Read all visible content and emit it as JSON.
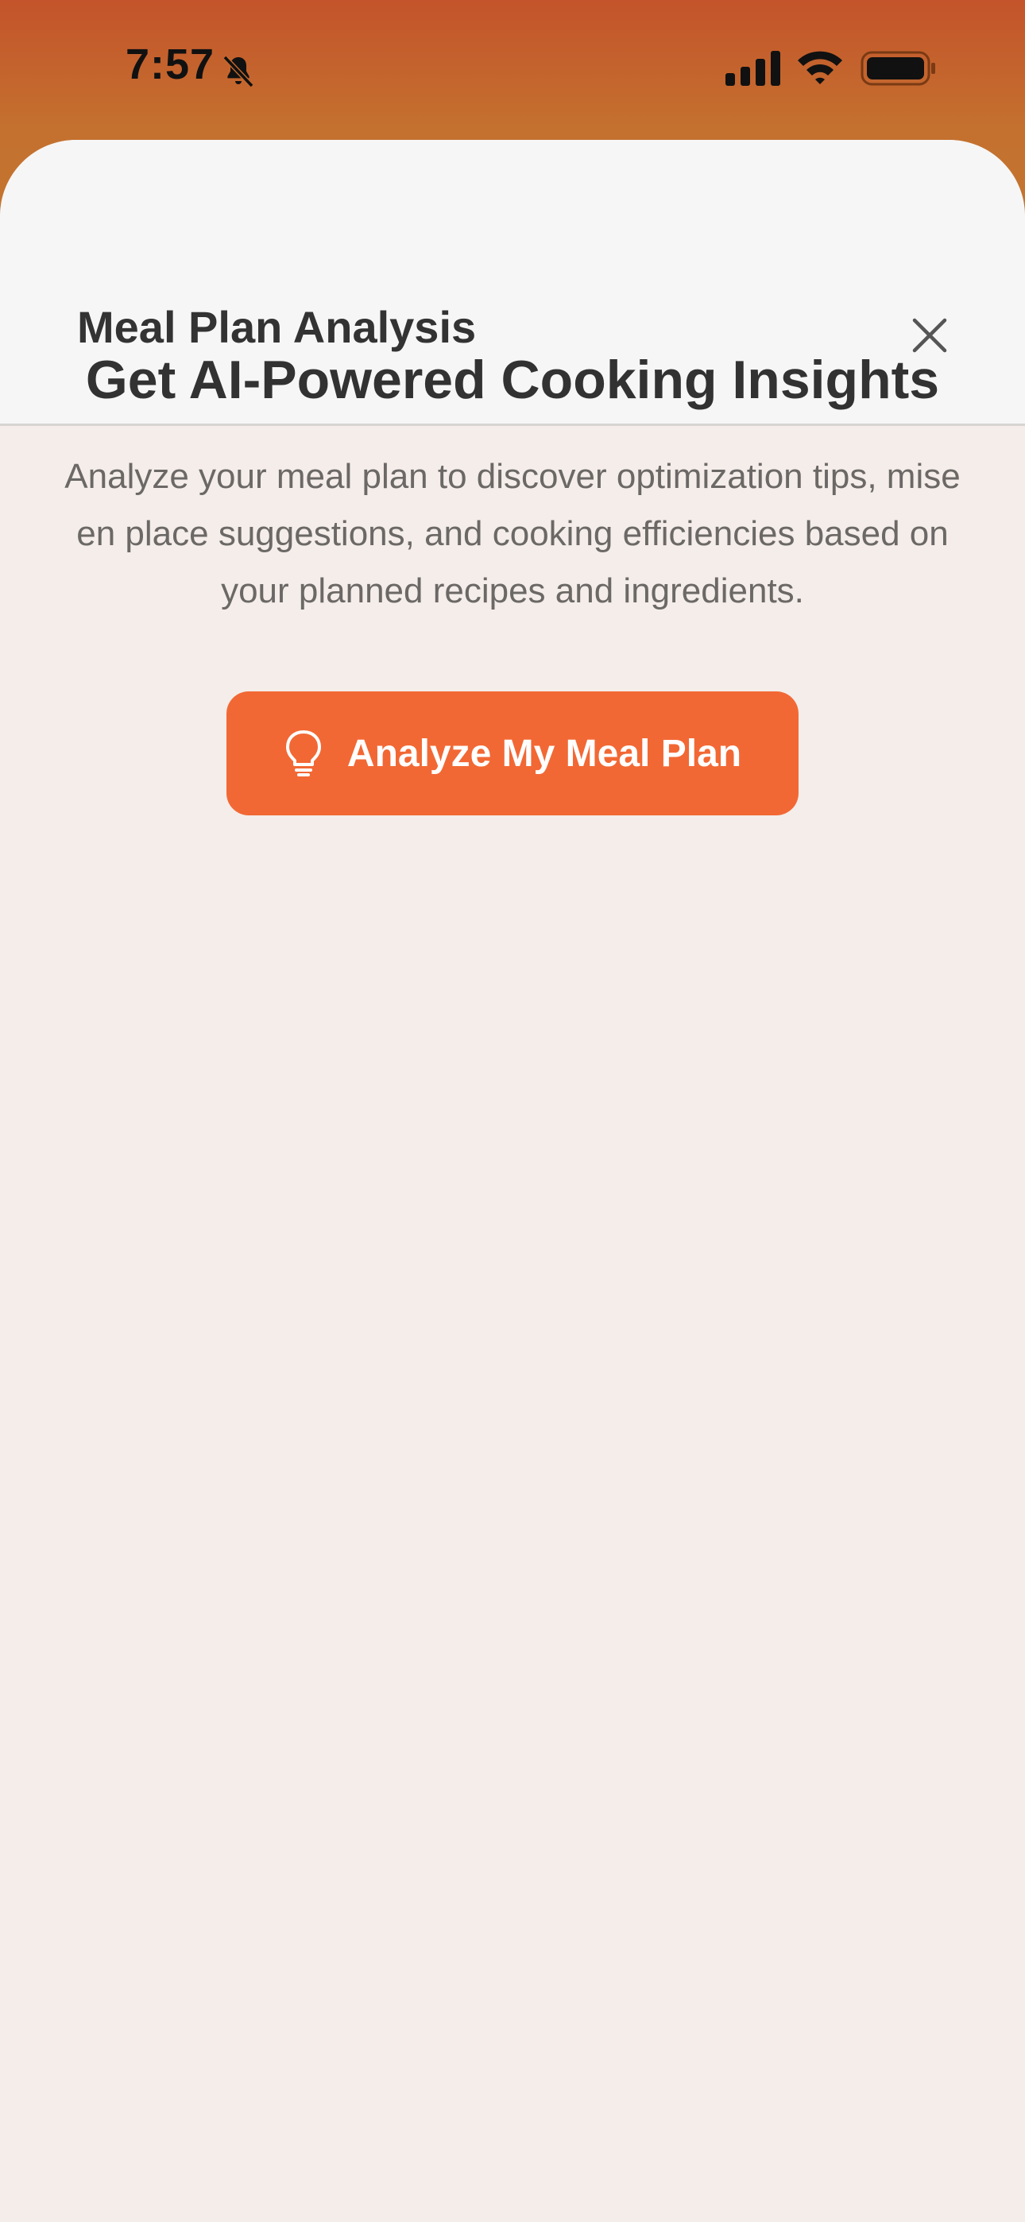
{
  "status_bar": {
    "time": "7:57",
    "icons": [
      "bell-muted-icon",
      "signal-icon",
      "wifi-icon",
      "battery-icon"
    ]
  },
  "sheet": {
    "title": "Meal Plan Analysis",
    "close_icon": "close-icon"
  },
  "content": {
    "headline": "Get AI-Powered Cooking Insights",
    "description": "Analyze your meal plan to discover optimization tips, mise en place suggestions, and cooking efficiencies based on your planned recipes and ingredients.",
    "analyze_button": {
      "label": "Analyze My Meal Plan",
      "icon": "lightbulb-icon"
    }
  },
  "colors": {
    "accent": "#f26834",
    "status_gradient_top": "#c4542b",
    "sheet_background": "#f4ede9",
    "header_background": "#f6f6f6",
    "title_text": "#333333",
    "body_text": "#6b6866"
  }
}
